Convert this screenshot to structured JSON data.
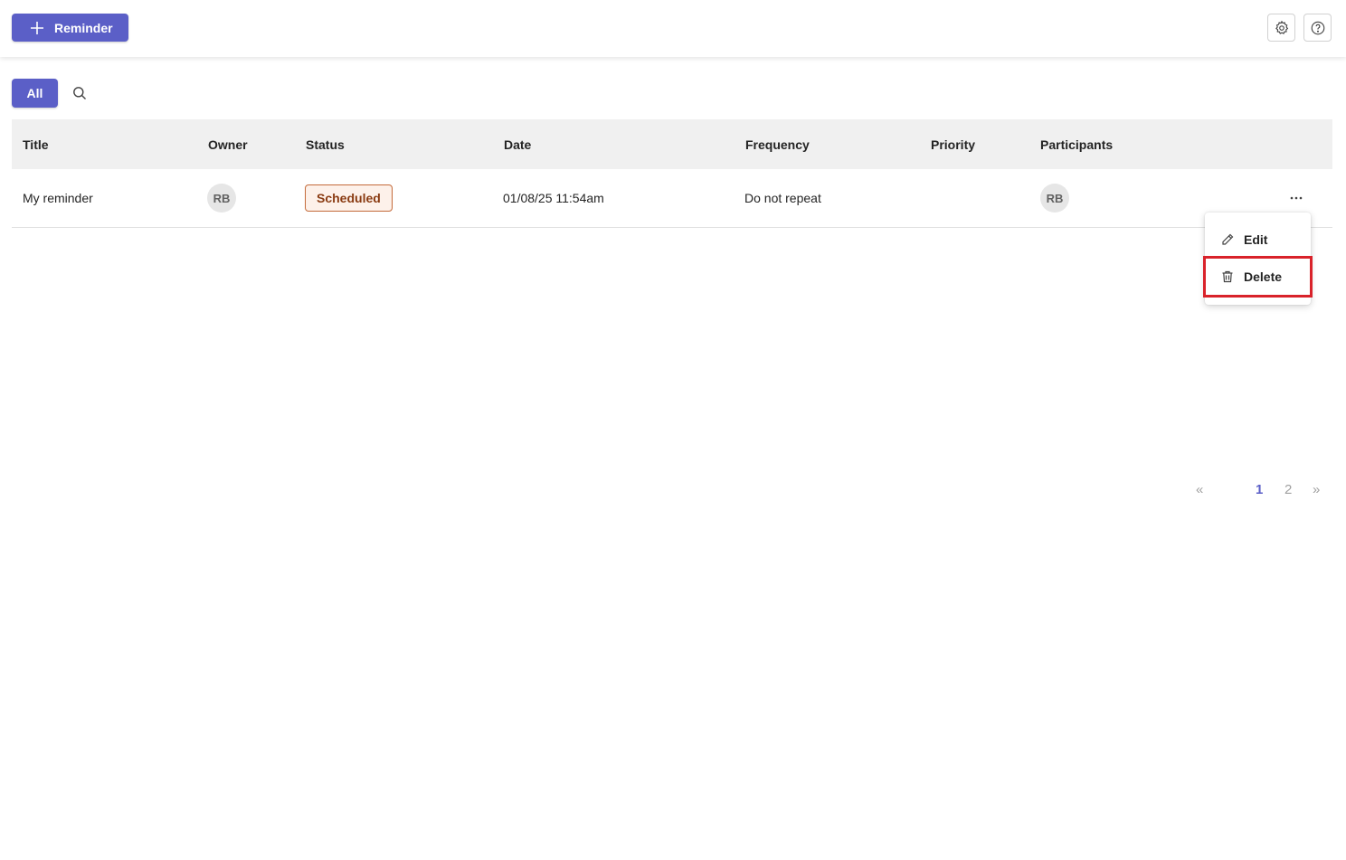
{
  "toolbar": {
    "add_label": "Reminder",
    "icons": {
      "add": "plus-icon",
      "settings": "gear-icon",
      "help": "question-circle-icon"
    }
  },
  "filters": {
    "all_label": "All",
    "search_icon": "search-icon"
  },
  "table": {
    "columns": [
      "Title",
      "Owner",
      "Status",
      "Date",
      "Frequency",
      "Priority",
      "Participants"
    ],
    "rows": [
      {
        "title": "My reminder",
        "owner": "RB",
        "status": "Scheduled",
        "date": "01/08/25 11:54am",
        "frequency": "Do not repeat",
        "priority": "",
        "participants": "RB"
      }
    ]
  },
  "context_menu": {
    "items": [
      {
        "label": "Edit",
        "icon": "pencil-icon"
      },
      {
        "label": "Delete",
        "icon": "trash-icon"
      }
    ]
  },
  "pagination": {
    "first": "«",
    "last": "»",
    "pages": [
      "1",
      "2"
    ],
    "current": "1"
  },
  "colors": {
    "accent": "#5b5fc7",
    "status_border": "#c46a3a",
    "status_text": "#8a3b12",
    "highlight": "#d9222a"
  }
}
